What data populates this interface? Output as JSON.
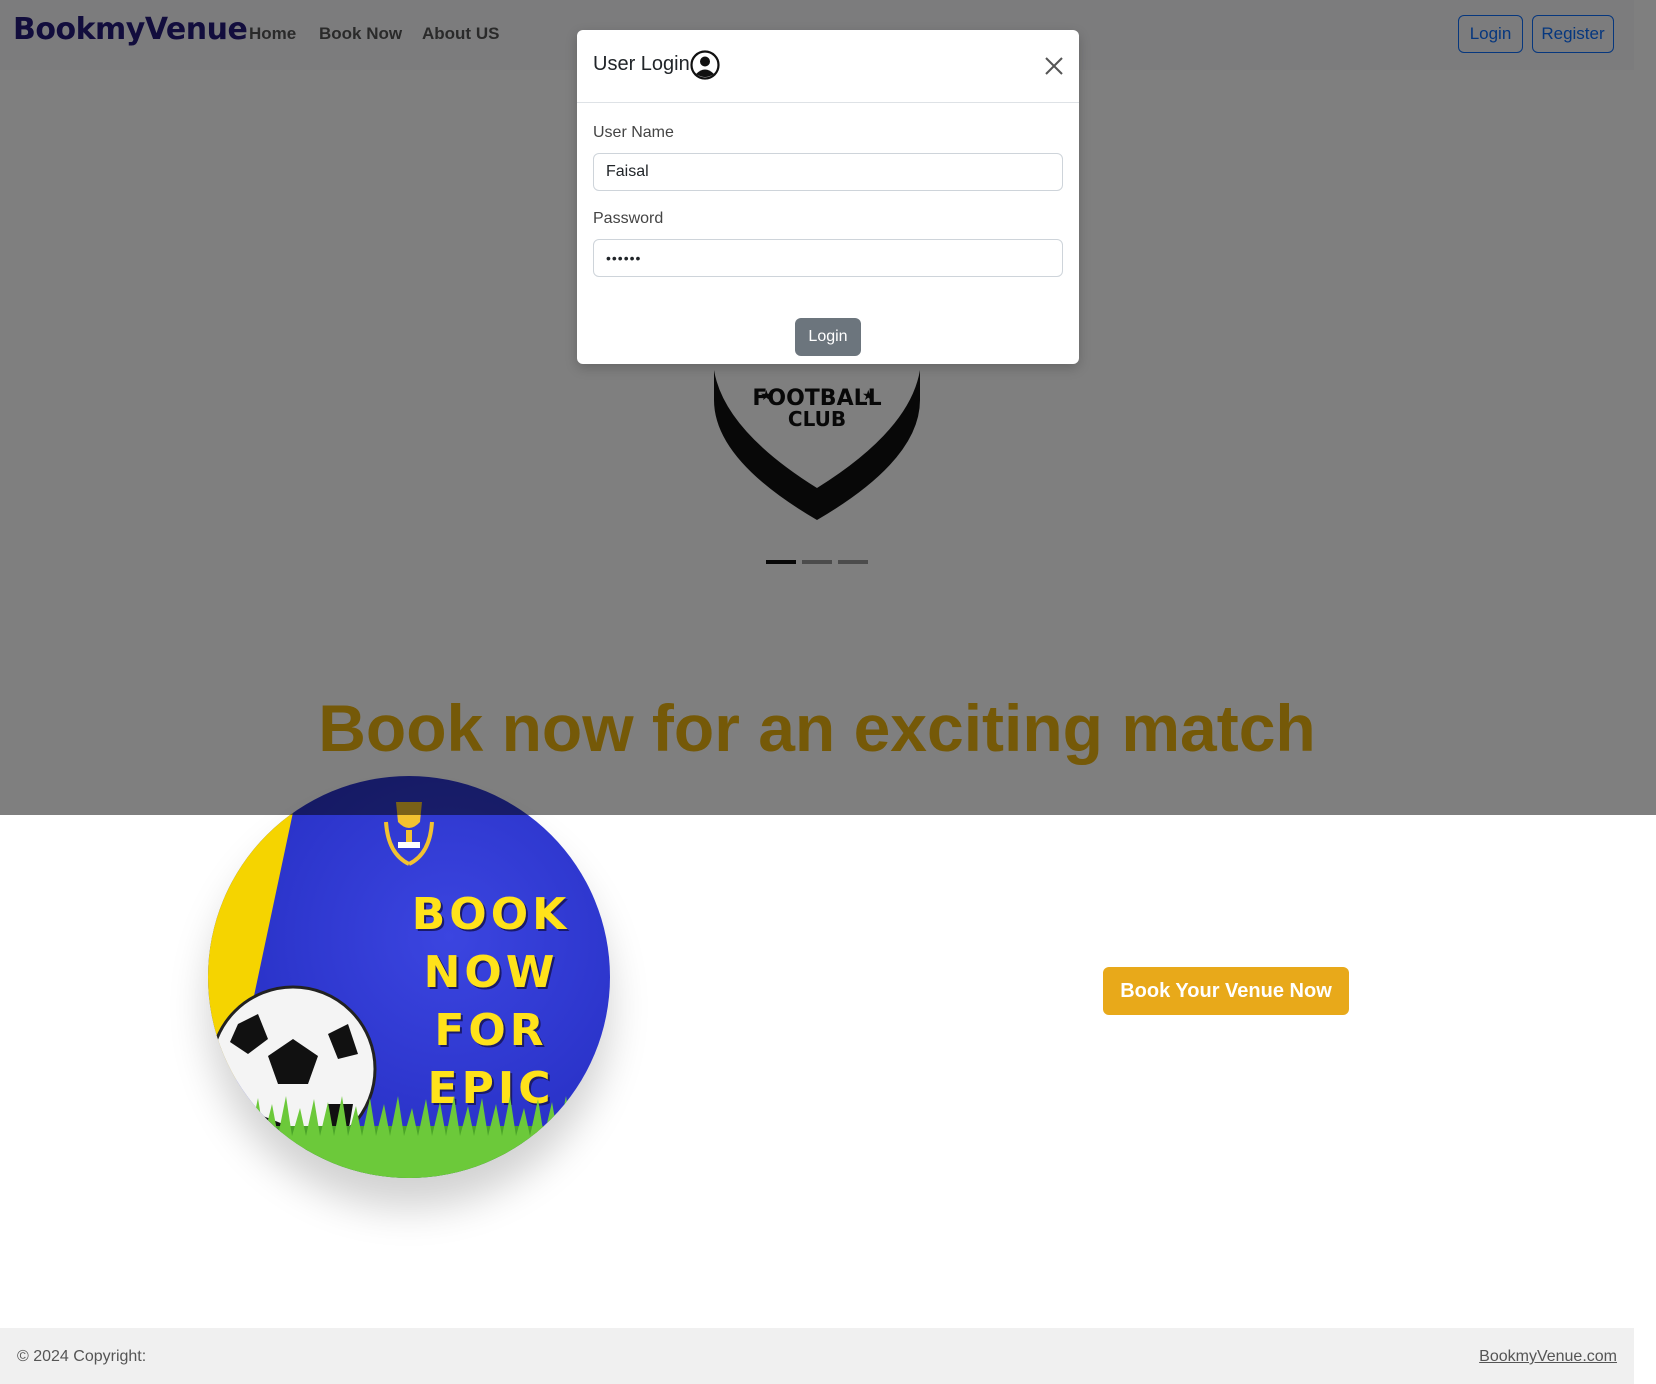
{
  "navbar": {
    "brand": "BookmyVenue",
    "links": [
      "Home",
      "Book Now",
      "About US"
    ],
    "login_label": "Login",
    "register_label": "Register"
  },
  "hero": {
    "crest_text_line1": "FOOTBALL",
    "crest_text_line2": "CLUB",
    "heading": "Book now for an exciting match",
    "indicators": 3,
    "active_indicator": 1
  },
  "promo": {
    "image_text": "BOOK NOW FOR EPIC MATCHES",
    "cta_label": "Book Your Venue Now"
  },
  "footer": {
    "copyright": "© 2024 Copyright:",
    "link": "BookmyVenue.com"
  },
  "modal": {
    "title": "User Login",
    "username_label": "User Name",
    "username_value": "Faisal",
    "password_label": "Password",
    "password_value": "••••••",
    "login_label": "Login"
  },
  "colors": {
    "brand": "#241b7a",
    "accent": "#ebb310",
    "cta": "#e8a91a",
    "primary_outline": "#0d6efd"
  }
}
